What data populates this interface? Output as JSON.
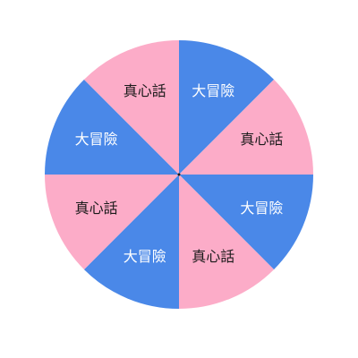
{
  "wheel": {
    "segments": [
      {
        "label": "大冒險",
        "color": "#4a88e8",
        "text_color": "#ffffff"
      },
      {
        "label": "真心話",
        "color": "#fcacc8",
        "text_color": "#1a1a1a"
      },
      {
        "label": "大冒險",
        "color": "#4a88e8",
        "text_color": "#ffffff"
      },
      {
        "label": "真心話",
        "color": "#fcacc8",
        "text_color": "#1a1a1a"
      },
      {
        "label": "大冒險",
        "color": "#4a88e8",
        "text_color": "#ffffff"
      },
      {
        "label": "真心話",
        "color": "#fcacc8",
        "text_color": "#1a1a1a"
      },
      {
        "label": "大冒險",
        "color": "#4a88e8",
        "text_color": "#ffffff"
      },
      {
        "label": "真心話",
        "color": "#fcacc8",
        "text_color": "#1a1a1a"
      }
    ],
    "center_color": "#1a1a1a"
  }
}
